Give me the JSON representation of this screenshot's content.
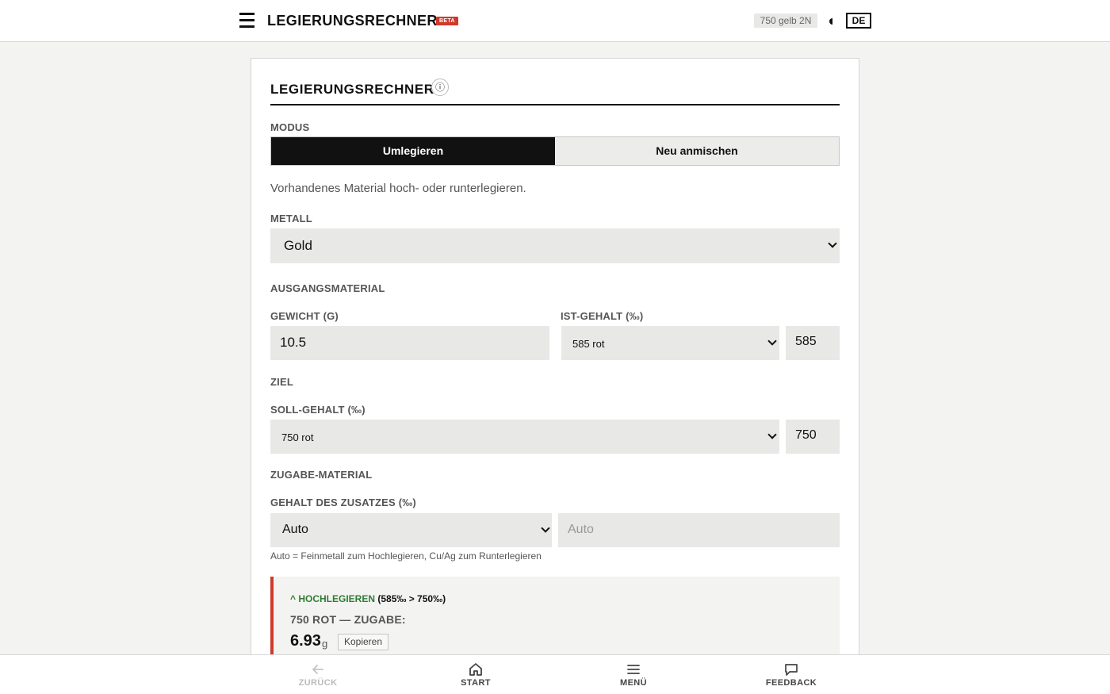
{
  "header": {
    "title": "LEGIERUNGSRECHNER",
    "badge": "BETA",
    "preset_chip": "750 gelb 2N",
    "language": "DE"
  },
  "card": {
    "title": "LEGIERUNGSRECHNER",
    "info_glyph": "ⓘ",
    "mode_label": "MODUS",
    "modes": [
      {
        "label": "Umlegieren",
        "active": true
      },
      {
        "label": "Neu anmischen",
        "active": false
      }
    ],
    "mode_description": "Vorhandenes Material hoch- oder runterlegieren.",
    "metal_label": "METALL",
    "metal_value": "Gold",
    "source_section": "AUSGANGSMATERIAL",
    "weight_label": "GEWICHT (G)",
    "weight_value": "10.5",
    "actual_label": "IST-GEHALT (‰)",
    "actual_select": "585 rot",
    "actual_value": "585",
    "target_section": "ZIEL",
    "target_label": "SOLL-GEHALT (‰)",
    "target_select": "750 rot",
    "target_value": "750",
    "addition_section": "ZUGABE-MATERIAL",
    "addition_label": "GEHALT DES ZUSATZES (‰)",
    "addition_select": "Auto",
    "addition_placeholder": "Auto",
    "addition_hint": "Auto = Feinmetall zum Hochlegieren, Cu/Ag zum Runterlegieren"
  },
  "result": {
    "direction": "^ HOCHLEGIEREN",
    "range": "(585‰ > 750‰)",
    "subtitle": "750 ROT — ZUGABE:",
    "amount": "6.93",
    "unit": "g",
    "copy_label": "Kopieren"
  },
  "bottom_nav": {
    "back": "ZURÜCK",
    "home": "START",
    "menu": "MENÜ",
    "feedback": "FEEDBACK"
  },
  "colors": {
    "accent_red": "#d0392b",
    "success_green": "#2e7d32",
    "dark": "#111111",
    "field_bg": "#e8e8e6"
  }
}
